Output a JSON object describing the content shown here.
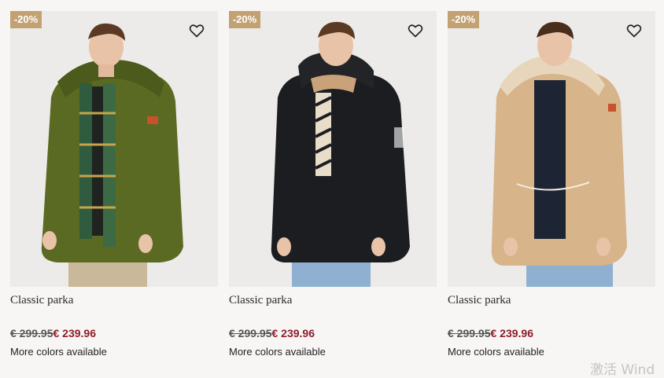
{
  "products": [
    {
      "badge": "-20%",
      "title": "Classic parka",
      "old_price": "€ 299.95",
      "new_price": "€ 239.96",
      "colors_note": "More colors available",
      "coat_color": "#5b6a23",
      "icon": "heart-outline"
    },
    {
      "badge": "-20%",
      "title": "Classic parka",
      "old_price": "€ 299.95",
      "new_price": "€ 239.96",
      "colors_note": "More colors available",
      "coat_color": "#1b1d20",
      "icon": "heart-outline"
    },
    {
      "badge": "-20%",
      "title": "Classic parka",
      "old_price": "€ 299.95",
      "new_price": "€ 239.96",
      "colors_note": "More colors available",
      "coat_color": "#d7b48a",
      "icon": "heart-outline"
    }
  ],
  "colors": {
    "badge_bg": "#c2a172",
    "sale_price": "#8e1b2c",
    "page_bg": "#f8f6f4",
    "image_bg": "#ecebe9"
  },
  "watermark": "激活 Wind"
}
